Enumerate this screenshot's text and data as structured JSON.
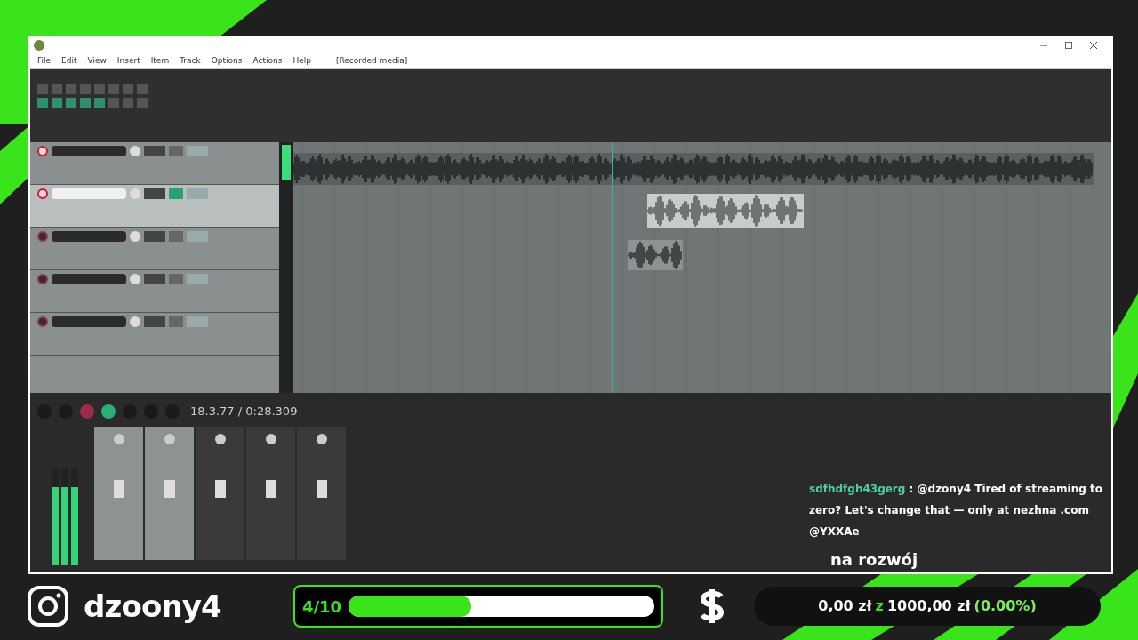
{
  "window": {
    "menu": [
      "File",
      "Edit",
      "View",
      "Insert",
      "Item",
      "Track",
      "Options",
      "Actions",
      "Help",
      "[Recorded media]"
    ],
    "tracks": [
      {
        "selected": false,
        "armed": true
      },
      {
        "selected": true,
        "armed": true
      },
      {
        "selected": false,
        "armed": false
      },
      {
        "selected": false,
        "armed": false
      },
      {
        "selected": false,
        "armed": false
      }
    ],
    "transport": {
      "time": "18.3.77 / 0:28.309"
    },
    "mixer": {
      "level": 0.8
    }
  },
  "chat": {
    "user": "sdfhdfgh43gerg",
    "message": ": @dzony4 Tired of streaming to zero? Let's change that — only at nezhna .com @YXXAe"
  },
  "goal_title": "na rozwój",
  "bottom_bar": {
    "handle": "dzoony4",
    "goal": {
      "count": "4/10",
      "level": 0.4
    },
    "donation": {
      "current": "0,00 zł",
      "connector": "z",
      "target": "1000,00 zł",
      "percent": "(0.00%)"
    }
  }
}
